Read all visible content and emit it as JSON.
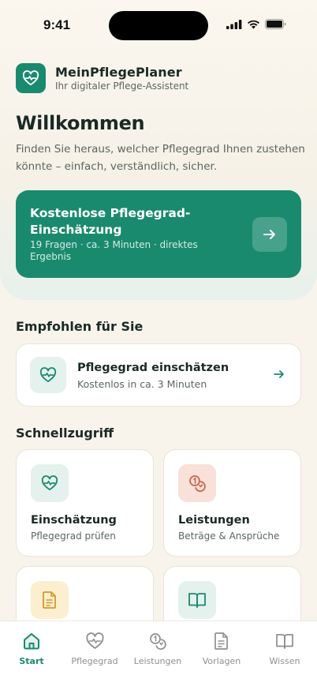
{
  "status_bar": {
    "time": "9:41"
  },
  "brand": {
    "name": "MeinPflegePlaner",
    "tagline": "Ihr digitaler Pflege-Assistent"
  },
  "welcome": {
    "title": "Willkommen",
    "subtitle": "Finden Sie heraus, welcher Pflegegrad Ihnen zustehen könnte – einfach, verständlich, sicher."
  },
  "cta": {
    "title": "Kostenlose Pflegegrad-Einschätzung",
    "subtitle": "19 Fragen · ca. 3 Minuten · direktes Ergebnis"
  },
  "recommended": {
    "section_title": "Empfohlen für Sie",
    "card_title": "Pflegegrad einschätzen",
    "card_subtitle": "Kostenlos in ca. 3 Minuten"
  },
  "quick_access": {
    "section_title": "Schnellzugriff",
    "items": [
      {
        "title": "Einschätzung",
        "subtitle": "Pflegegrad prüfen",
        "icon": "heart-pulse-icon"
      },
      {
        "title": "Leistungen",
        "subtitle": "Beträge & Ansprüche",
        "icon": "coins-icon"
      },
      {
        "title": "",
        "subtitle": "",
        "icon": "document-icon"
      },
      {
        "title": "",
        "subtitle": "",
        "icon": "book-icon"
      }
    ]
  },
  "tab_bar": {
    "active": "Start",
    "items": [
      {
        "label": "Start",
        "icon": "home-icon"
      },
      {
        "label": "Pflegegrad",
        "icon": "heart-pulse-icon"
      },
      {
        "label": "Leistungen",
        "icon": "coins-icon"
      },
      {
        "label": "Vorlagen",
        "icon": "document-icon"
      },
      {
        "label": "Wissen",
        "icon": "book-icon"
      }
    ]
  },
  "colors": {
    "primary": "#1a8a6e",
    "background": "#f8f4ec",
    "mint_tint": "#e4f1ec",
    "rose_tint": "#f9e1da",
    "amber_tint": "#fbefcf"
  }
}
